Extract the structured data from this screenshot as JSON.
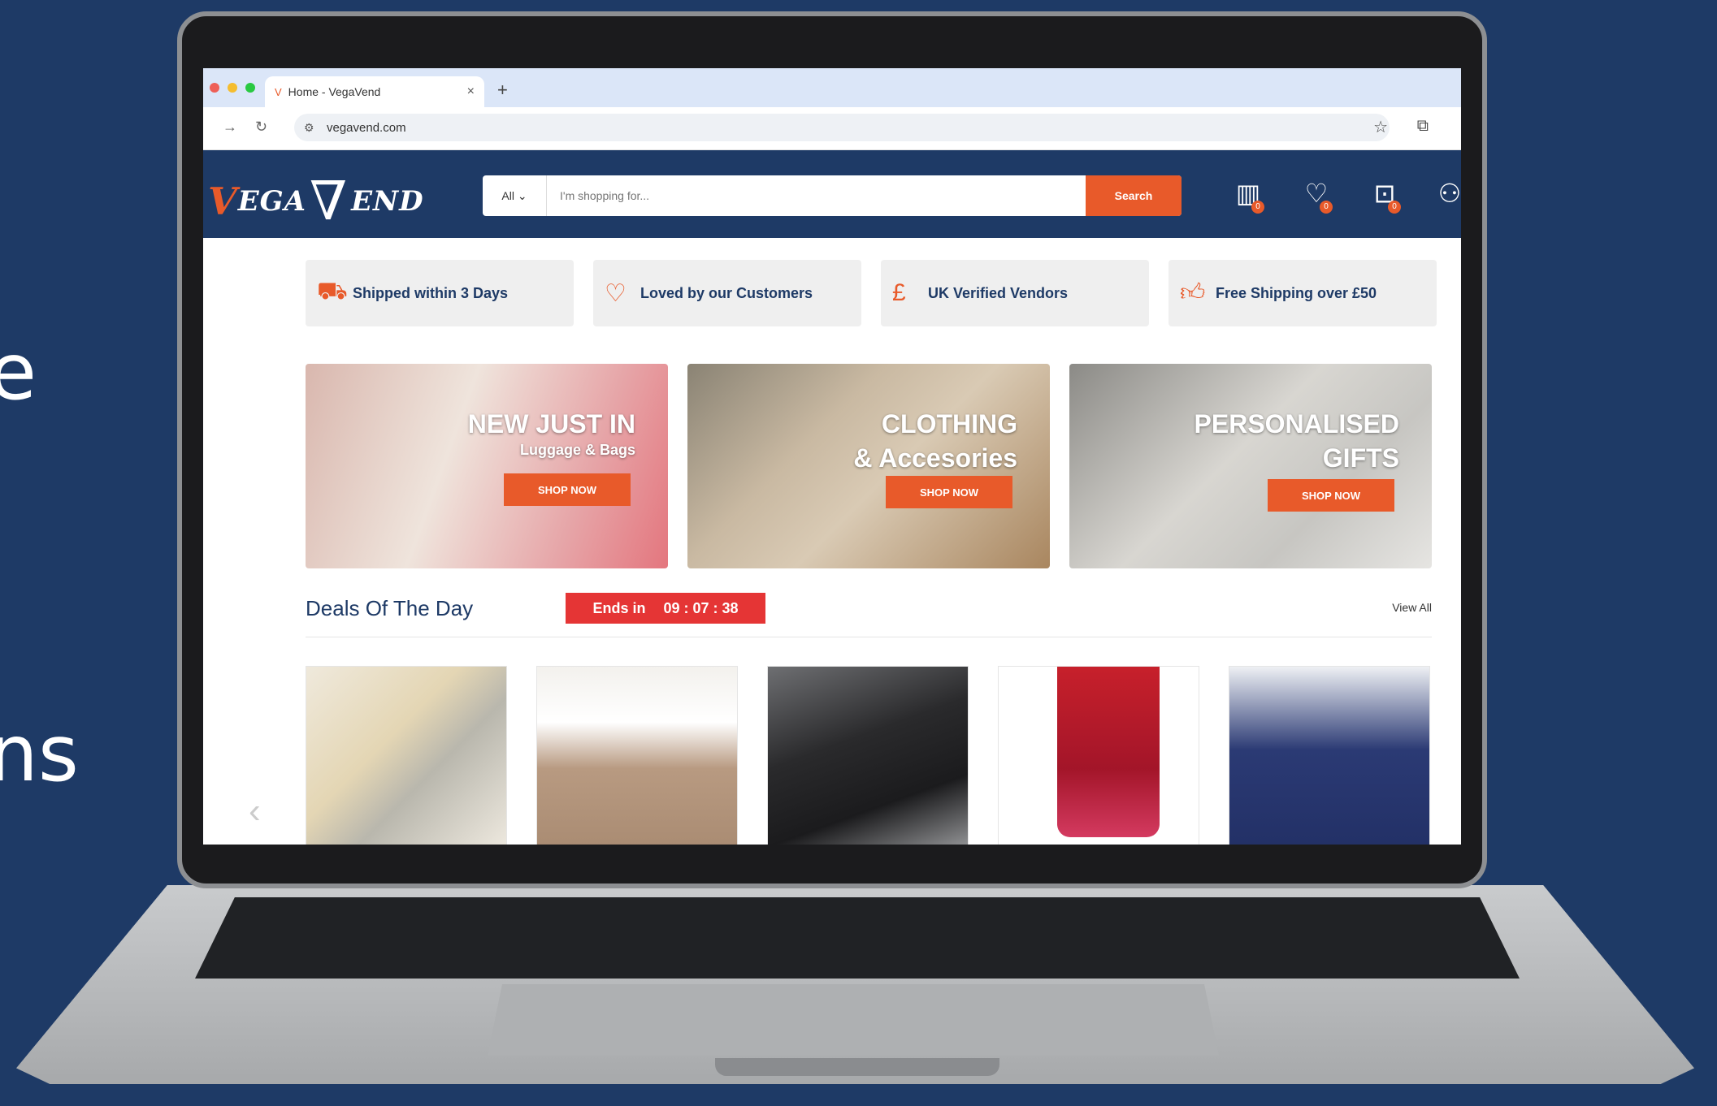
{
  "background_text": {
    "line1": "e",
    "line2": "ns"
  },
  "browser": {
    "tab_title": "Home - VegaVend",
    "url": "vegavend.com",
    "colors": {
      "tab_bar": "#dbe6f8"
    }
  },
  "site": {
    "brand": {
      "part1": "EGA",
      "part2": "END"
    },
    "search": {
      "category": "All",
      "placeholder": "I'm shopping for...",
      "button": "Search"
    },
    "header_icons": [
      {
        "name": "compare-icon",
        "count": "0"
      },
      {
        "name": "wishlist-icon",
        "count": "0"
      },
      {
        "name": "cart-icon",
        "count": "0"
      },
      {
        "name": "account-icon"
      }
    ],
    "features": [
      {
        "icon": "truck-icon",
        "label": "Shipped within 3 Days"
      },
      {
        "icon": "heart-icon",
        "label": "Loved by our Customers"
      },
      {
        "icon": "pound-icon",
        "label": "UK Verified Vendors"
      },
      {
        "icon": "thumbs-up-icon",
        "label": "Free Shipping over £50"
      }
    ],
    "banners": [
      {
        "title": "NEW JUST IN",
        "subtitle": "Luggage & Bags",
        "button": "SHOP NOW"
      },
      {
        "title": "CLOTHING",
        "subtitle": "& Accesories",
        "button": "SHOP NOW"
      },
      {
        "title": "PERSONALISED",
        "subtitle": "GIFTS",
        "button": "SHOP NOW"
      }
    ],
    "deals": {
      "title": "Deals Of The Day",
      "ends_label": "Ends in",
      "timer": "09 : 07 : 38",
      "view_all": "View All"
    },
    "colors": {
      "navy": "#1e3a66",
      "accent": "#e85a2a",
      "timer": "#e53535"
    }
  }
}
